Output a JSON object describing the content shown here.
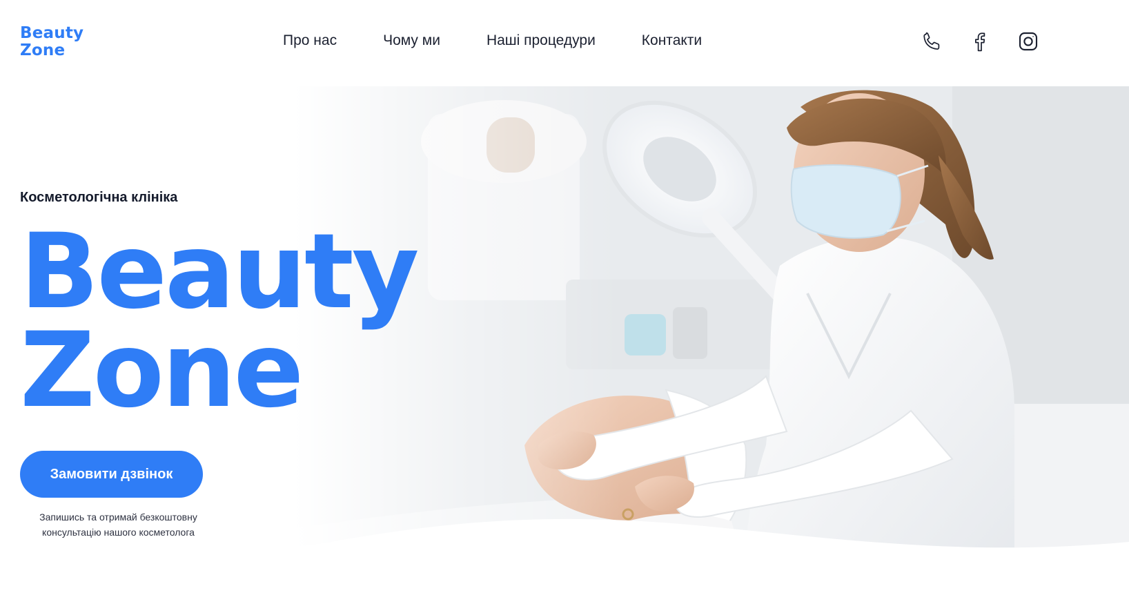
{
  "brand": {
    "logo_line1": "Beauty",
    "logo_line2": "Zone",
    "accent_color": "#2f7df6"
  },
  "nav": {
    "items": [
      {
        "label": "Про нас"
      },
      {
        "label": "Чому ми"
      },
      {
        "label": "Наші процедури"
      },
      {
        "label": "Контакти"
      }
    ]
  },
  "social": {
    "icons": [
      "phone-icon",
      "facebook-icon",
      "instagram-icon"
    ]
  },
  "hero": {
    "eyebrow": "Косметологічна клініка",
    "title_line1": "Beauty",
    "title_line2": "Zone",
    "cta_label": "Замовити дзвінок",
    "note_line1": "Запишись та отримай безкоштовну",
    "note_line2": "консультацію нашого косметолога",
    "photo_subject": "cosmetologist-treating-client-photo"
  }
}
